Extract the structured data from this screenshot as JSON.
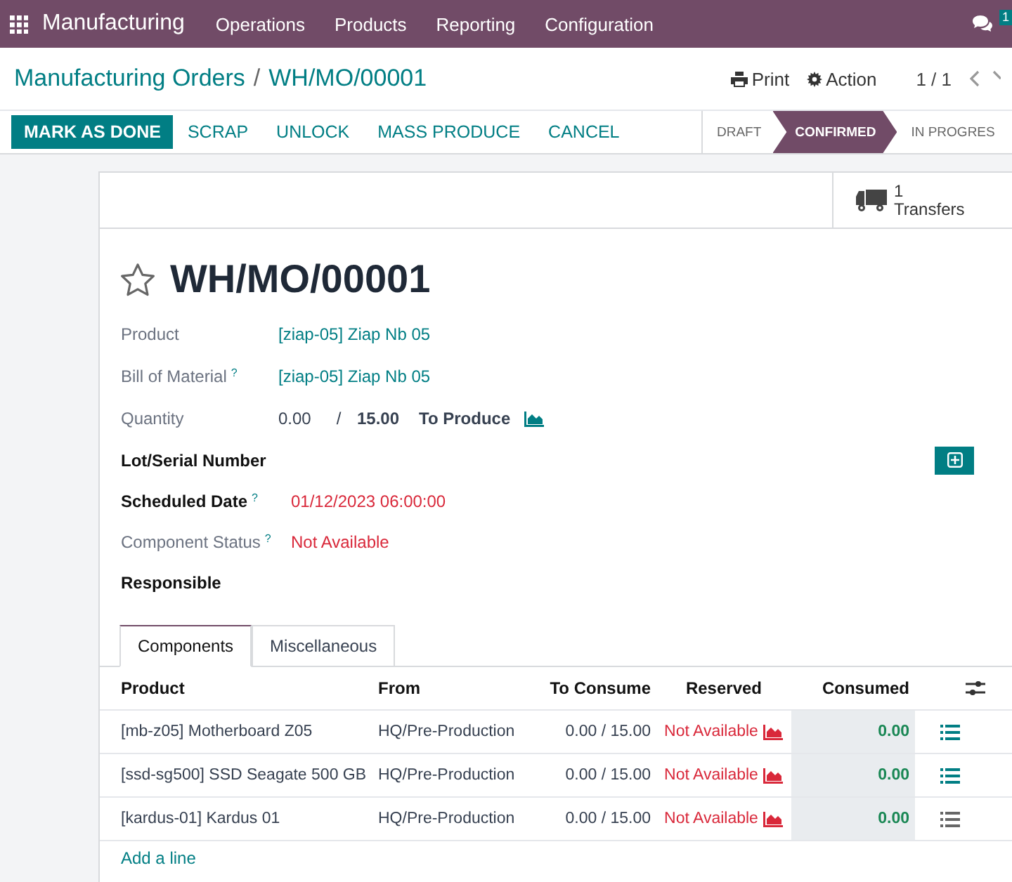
{
  "navbar": {
    "app": "Manufacturing",
    "menus": [
      "Operations",
      "Products",
      "Reporting",
      "Configuration"
    ],
    "chat_badge": "1"
  },
  "breadcrumb": {
    "parent": "Manufacturing Orders",
    "separator": "/",
    "current": "WH/MO/00001"
  },
  "actions": {
    "print": "Print",
    "action": "Action",
    "pager": "1 / 1"
  },
  "buttons": [
    {
      "label": "MARK AS DONE",
      "kind": "primary"
    },
    {
      "label": "SCRAP",
      "kind": "secondary"
    },
    {
      "label": "UNLOCK",
      "kind": "secondary"
    },
    {
      "label": "MASS PRODUCE",
      "kind": "secondary"
    },
    {
      "label": "CANCEL",
      "kind": "secondary"
    }
  ],
  "stages": [
    {
      "label": "DRAFT",
      "selected": false
    },
    {
      "label": "CONFIRMED",
      "selected": true
    },
    {
      "label": "IN PROGRES",
      "selected": false
    }
  ],
  "smart_button": {
    "count": "1",
    "label": "Transfers"
  },
  "title": "WH/MO/00001",
  "fields": [
    {
      "label": "Product",
      "required": false,
      "kind": "link",
      "value": "[ziap-05] Ziap Nb 05"
    },
    {
      "label": "Bill of Material",
      "help": "?",
      "required": false,
      "kind": "link",
      "value": "[ziap-05] Ziap Nb 05"
    },
    {
      "label": "Quantity",
      "required": false,
      "kind": "quantity",
      "done": "0.00",
      "separator": "/",
      "total": "15.00",
      "unit": "To Produce"
    },
    {
      "label": "Lot/Serial Number",
      "required": true,
      "kind": "lot"
    },
    {
      "label": "Scheduled Date",
      "help": "?",
      "required": true,
      "kind": "alert",
      "value": "01/12/2023 06:00:00"
    },
    {
      "label": "Component Status",
      "help": "?",
      "required": false,
      "kind": "alert",
      "value": "Not Available"
    },
    {
      "label": "Responsible",
      "required": true,
      "kind": "empty"
    }
  ],
  "tabs": [
    {
      "label": "Components",
      "selected": true
    },
    {
      "label": "Miscellaneous",
      "selected": false
    }
  ],
  "table": {
    "columns": [
      "Product",
      "From",
      "To Consume",
      "Reserved",
      "Consumed"
    ],
    "rows": [
      {
        "product": "[mb-z05] Motherboard Z05",
        "from": "HQ/Pre-Production",
        "to_consume": "0.00 /  15.00",
        "reserved": "Not Available",
        "consumed": "0.00",
        "details_highlighted": true
      },
      {
        "product": "[ssd-sg500] SSD Seagate 500 GB",
        "from": "HQ/Pre-Production",
        "to_consume": "0.00 /  15.00",
        "reserved": "Not Available",
        "consumed": "0.00",
        "details_highlighted": true
      },
      {
        "product": "[kardus-01] Kardus 01",
        "from": "HQ/Pre-Production",
        "to_consume": "0.00 /  15.00",
        "reserved": "Not Available",
        "consumed": "0.00",
        "details_highlighted": false
      }
    ],
    "add_line": "Add a line"
  }
}
